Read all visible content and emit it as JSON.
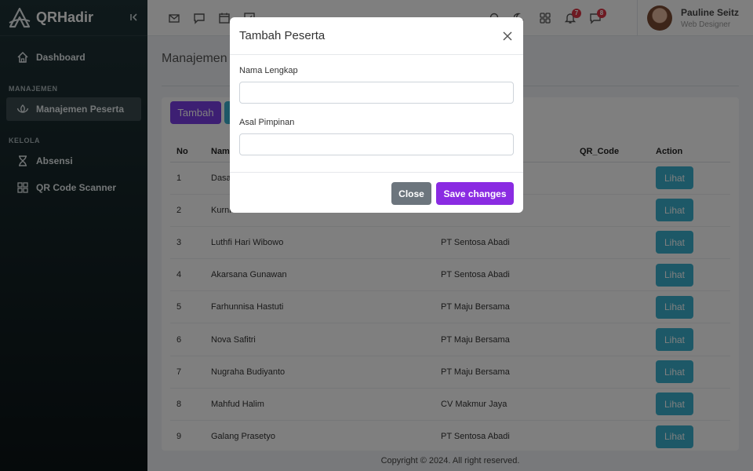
{
  "brand": {
    "name": "QRHadir"
  },
  "sidebar": {
    "dashboard": "Dashboard",
    "section_manajemen": "MANAJEMEN",
    "manajemen_peserta": "Manajemen Peserta",
    "section_kelola": "KELOLA",
    "absensi": "Absensi",
    "qr_scanner": "QR Code Scanner"
  },
  "topbar": {
    "notifications_count": "7",
    "messages_count": "8"
  },
  "user": {
    "name": "Pauline Seitz",
    "role": "Web Designer"
  },
  "page": {
    "title": "Manajemen",
    "add_button": "Tambah"
  },
  "table": {
    "headers": {
      "no": "No",
      "nama": "Nama",
      "qr_code": "QR_Code",
      "action": "Action"
    },
    "rows": [
      {
        "no": "1",
        "nama": "Dasa",
        "asal": "",
        "action": "Lihat"
      },
      {
        "no": "2",
        "nama": "Kurni",
        "asal": "",
        "action": "Lihat"
      },
      {
        "no": "3",
        "nama": "Luthfi Hari Wibowo",
        "asal": "PT Sentosa Abadi",
        "action": "Lihat"
      },
      {
        "no": "4",
        "nama": "Akarsana Gunawan",
        "asal": "PT Sentosa Abadi",
        "action": "Lihat"
      },
      {
        "no": "5",
        "nama": "Farhunnisa Hastuti",
        "asal": "PT Maju Bersama",
        "action": "Lihat"
      },
      {
        "no": "6",
        "nama": "Nova Safitri",
        "asal": "PT Maju Bersama",
        "action": "Lihat"
      },
      {
        "no": "7",
        "nama": "Nugraha Budiyanto",
        "asal": "PT Maju Bersama",
        "action": "Lihat"
      },
      {
        "no": "8",
        "nama": "Mahfud Halim",
        "asal": "CV Makmur Jaya",
        "action": "Lihat"
      },
      {
        "no": "9",
        "nama": "Galang Prasetyo",
        "asal": "PT Sentosa Abadi",
        "action": "Lihat"
      }
    ]
  },
  "footer": {
    "text": "Copyright © 2024. All right reserved."
  },
  "modal": {
    "title": "Tambah Peserta",
    "field_nama_label": "Nama Lengkap",
    "field_nama_value": "",
    "field_asal_label": "Asal Pimpinan",
    "field_asal_value": "",
    "close_label": "Close",
    "save_label": "Save changes"
  },
  "colors": {
    "primary_purple": "#7b3ee6",
    "save_purple": "#8a2be2",
    "info_blue": "#3ab1cf",
    "secondary_gray": "#6c757d",
    "badge_red": "#dc3545"
  }
}
